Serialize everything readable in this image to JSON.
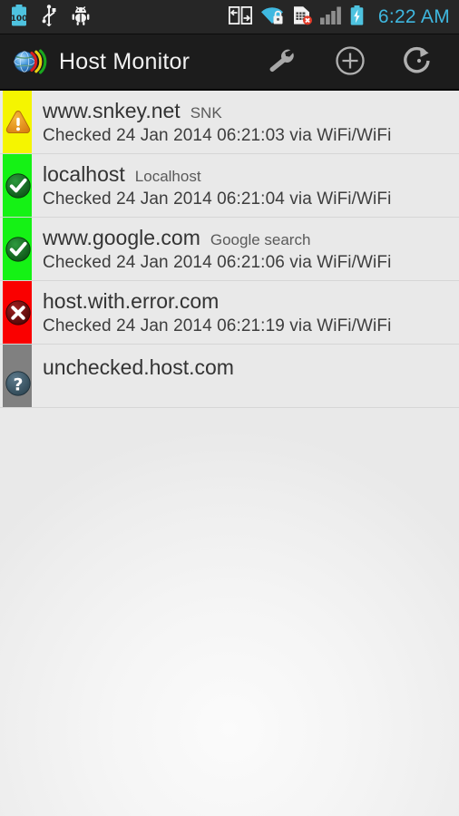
{
  "statusbar": {
    "time": "6:22 AM",
    "battery_level_text": "100",
    "left_icons": [
      "battery-100-icon",
      "usb-icon",
      "android-debug-bug-icon"
    ],
    "right_icons": [
      "data-transfer-icon",
      "wifi-secured-icon",
      "sim-card-error-icon",
      "cellular-signal-icon",
      "battery-charging-icon"
    ],
    "accent_color": "#3fb8e0",
    "bg_color": "#262626"
  },
  "actionbar": {
    "title": "Host Monitor",
    "logo_icon": "globe-signal-logo-icon",
    "bg_color": "#1c1c1c",
    "actions": [
      {
        "name": "settings-wrench-button",
        "icon": "wrench-icon",
        "label": "Settings"
      },
      {
        "name": "add-host-button",
        "icon": "plus-circle-icon",
        "label": "Add host"
      },
      {
        "name": "refresh-button",
        "icon": "refresh-icon",
        "label": "Refresh"
      }
    ]
  },
  "hosts": [
    {
      "host": "www.snkey.net",
      "description": "SNK",
      "status": "warning",
      "status_icon": "warning-triangle-icon",
      "band_color": "#f5f500",
      "subtitle": "Checked 24 Jan 2014 06:21:03 via WiFi/WiFi"
    },
    {
      "host": "localhost",
      "description": "Localhost",
      "status": "ok",
      "status_icon": "check-circle-icon",
      "band_color": "#15f215",
      "subtitle": "Checked 24 Jan 2014 06:21:04 via WiFi/WiFi"
    },
    {
      "host": "www.google.com",
      "description": "Google search",
      "status": "ok",
      "status_icon": "check-circle-icon",
      "band_color": "#15f215",
      "subtitle": "Checked 24 Jan 2014 06:21:06 via WiFi/WiFi"
    },
    {
      "host": "host.with.error.com",
      "description": "",
      "status": "error",
      "status_icon": "error-circle-icon",
      "band_color": "#fa0000",
      "subtitle": "Checked 24 Jan 2014 06:21:19 via WiFi/WiFi"
    },
    {
      "host": "unchecked.host.com",
      "description": "",
      "status": "unchecked",
      "status_icon": "question-circle-icon",
      "band_color": "#808080",
      "subtitle": ""
    }
  ]
}
